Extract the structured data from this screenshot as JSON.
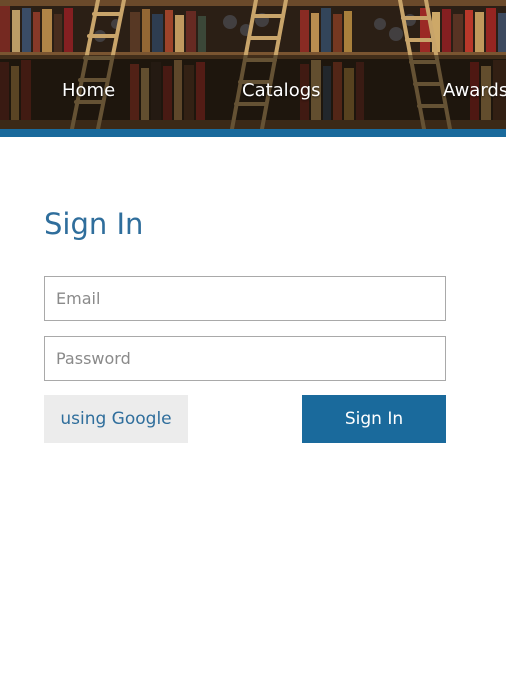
{
  "nav": {
    "items": [
      {
        "label": "Home"
      },
      {
        "label": "Catalogs"
      },
      {
        "label": "Awards"
      }
    ]
  },
  "signin": {
    "title": "Sign In",
    "email_placeholder": "Email",
    "password_placeholder": "Password",
    "google_button": "using Google",
    "submit_button": "Sign In"
  },
  "colors": {
    "accent": "#1a6a9c",
    "title": "#2f6e9c",
    "secondary_button": "#ececec"
  }
}
